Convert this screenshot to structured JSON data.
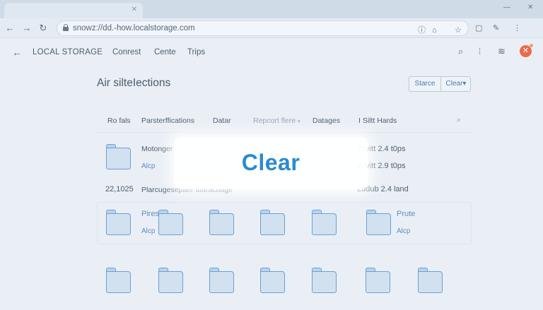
{
  "browser": {
    "url": "snowz://dd.-how.localstorage.com",
    "nav": {
      "back": "←",
      "forward": "→",
      "reload": "↻"
    },
    "omnibox_icons": [
      "ⓘ",
      "⌂",
      "☆"
    ],
    "toolbar_icons": [
      "▢",
      "✎",
      "⋮"
    ],
    "window_controls": [
      "—",
      "✕"
    ]
  },
  "header": {
    "back_glyph": "←",
    "title": "LOCAL STORAGE",
    "nav": [
      "Conrest",
      "Cente",
      "Trips"
    ],
    "icons": [
      "⌕",
      "⦙",
      "≋"
    ],
    "close_glyph": "✕"
  },
  "section": {
    "title": "Air silteIections",
    "actions": {
      "store": "Starce",
      "clear": "Clear▾"
    }
  },
  "table": {
    "headers": [
      "Ro fals",
      "Parsterffications",
      "Datar",
      "Repcort flere",
      "Datages",
      "I Siltt Hards"
    ],
    "report_caret": "▾",
    "search_glyph": "⌕",
    "rows": [
      {
        "name": "Motonger",
        "link": "Alcp",
        "meta1": "2dvitt 2.4 t0ps",
        "meta2": "2dvitt 2.9 t0ps"
      },
      {
        "id": "22,1025",
        "name": "Plarcugesepaer tuttracuage",
        "meta": "2ddub 2.4 land"
      }
    ],
    "grid_items": [
      {
        "title": "Pires",
        "link": "Alcp"
      },
      {
        "title": "Prute",
        "link": "Alcp"
      }
    ]
  },
  "toast": {
    "label": "Clear"
  },
  "colors": {
    "accent": "#2a8ad1",
    "folder_stroke": "#6aa0d5",
    "folder_fill": "#d2e1f0",
    "badge": "#ec6a4c",
    "background": "#e9eff5"
  }
}
